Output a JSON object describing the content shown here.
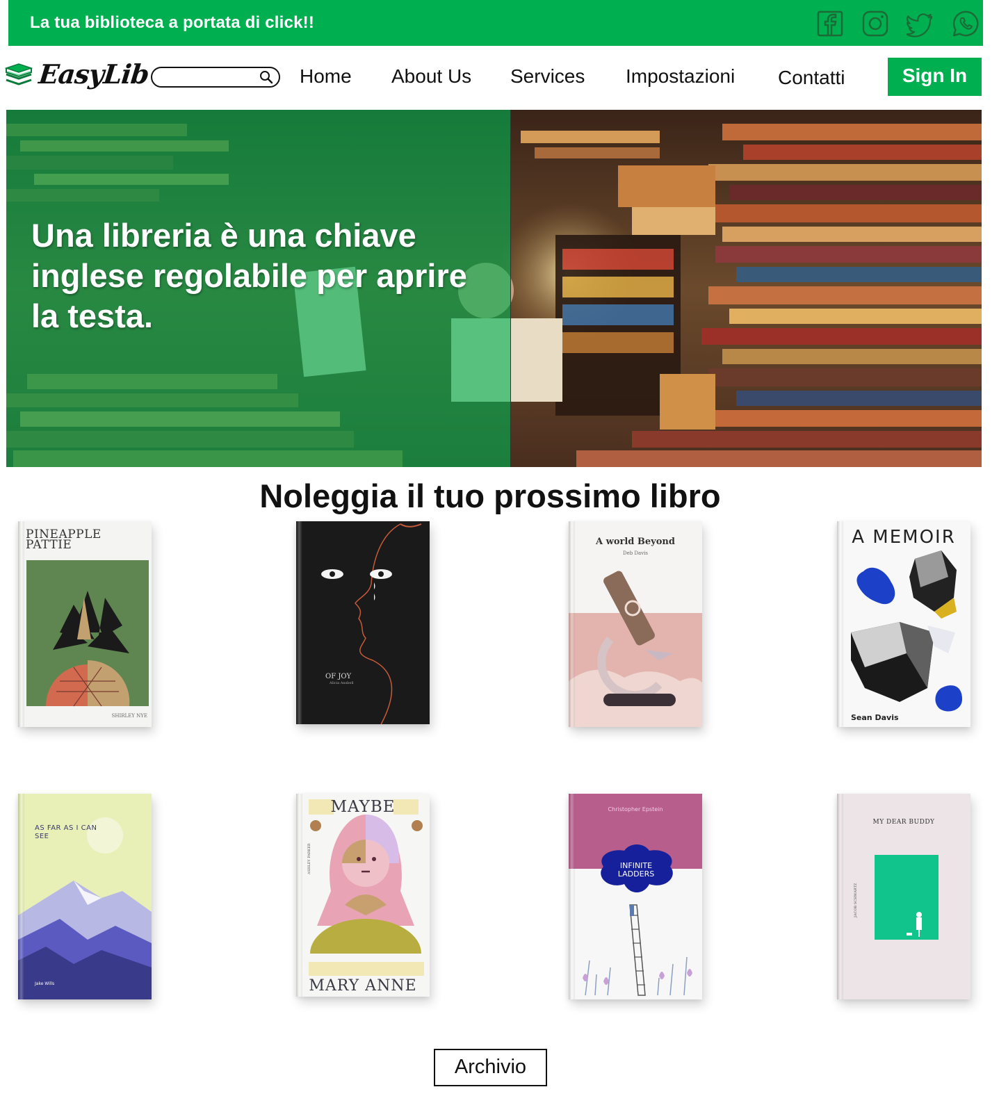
{
  "topbar": {
    "tagline": "La tua biblioteca a portata di click!!",
    "social_icons": [
      "facebook-icon",
      "instagram-icon",
      "twitter-icon",
      "whatsapp-icon"
    ]
  },
  "nav": {
    "logo_text": "EasyLib",
    "search_placeholder": "",
    "links": [
      "Home",
      "About Us",
      "Services",
      "Impostazioni",
      "Contatti"
    ],
    "signin_label": "Sign In"
  },
  "hero": {
    "quote": "Una libreria è una chiave inglese regolabile per aprire la testa."
  },
  "section": {
    "title": "Noleggia il tuo prossimo libro"
  },
  "books": [
    {
      "title": "PINEAPPLE PATTIE",
      "author": "SHIRLEY NYE"
    },
    {
      "title": "OF JOY",
      "author": "Alicia Ansbell"
    },
    {
      "title": "A world Beyond",
      "author": "Deb Davis"
    },
    {
      "title": "A MEMOIR",
      "author": "Sean Davis"
    },
    {
      "title": "AS FAR AS I CAN SEE",
      "author": "Jake Wills"
    },
    {
      "title": "MAYBE",
      "author": "MARY ANNE",
      "spine_author": "ASHLEY PARKER"
    },
    {
      "title": "INFINITE LADDERS",
      "author": "Christopher Epstein"
    },
    {
      "title": "MY DEAR BUDDY",
      "author": "JACOB SCHWARTZ"
    }
  ],
  "archive_button": "Archivio",
  "colors": {
    "brand_green": "#00b050",
    "text": "#111111",
    "white": "#ffffff"
  }
}
